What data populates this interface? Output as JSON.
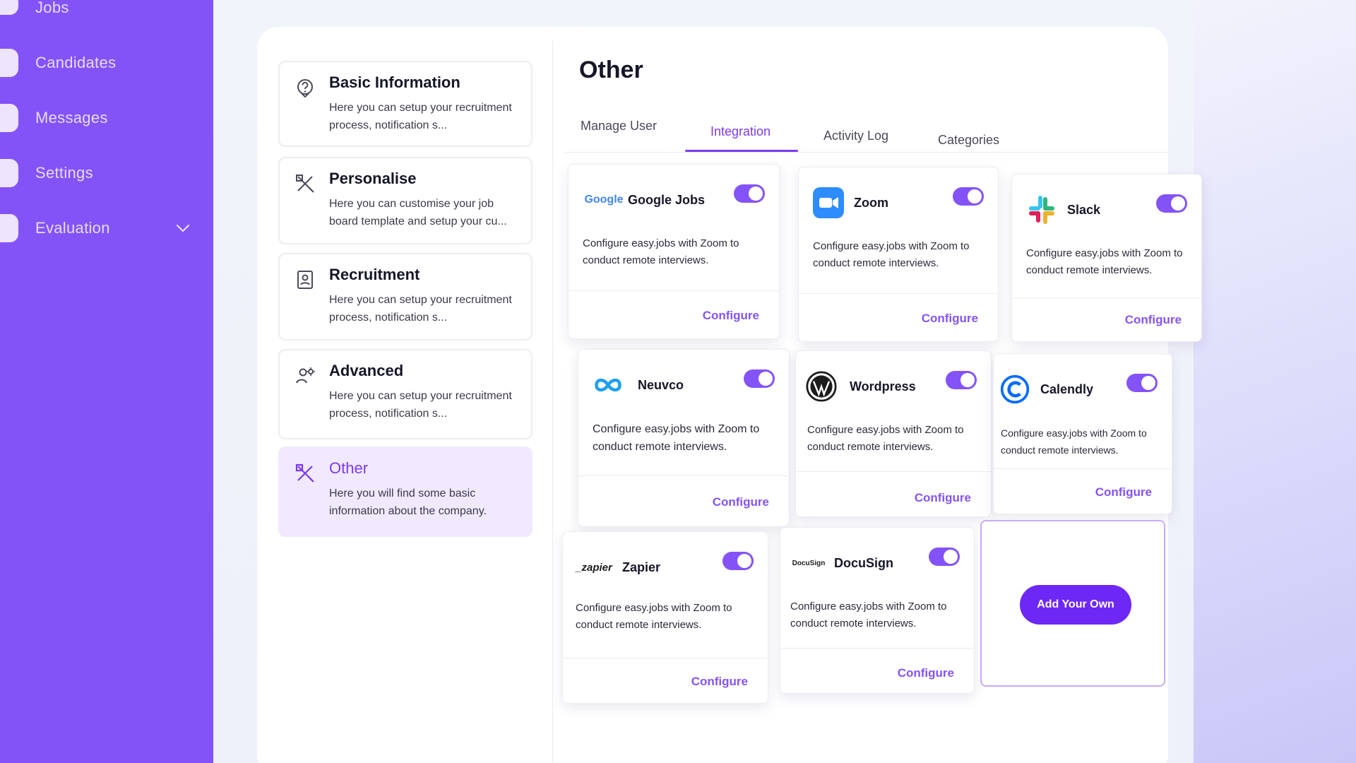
{
  "sidebar": {
    "items": [
      {
        "label": "Jobs"
      },
      {
        "label": "Candidates"
      },
      {
        "label": "Messages"
      },
      {
        "label": "Settings"
      },
      {
        "label": "Evaluation"
      }
    ]
  },
  "settings_list": [
    {
      "title": "Basic Information",
      "desc": "Here you can setup your recruitment process, notification s...",
      "icon": "question-circle-icon"
    },
    {
      "title": "Personalise",
      "desc": "Here you can customise your job board template and setup your cu...",
      "icon": "pencil-ruler-icon"
    },
    {
      "title": "Recruitment",
      "desc": "Here you can setup your recruitment process, notification s...",
      "icon": "id-card-icon"
    },
    {
      "title": "Advanced",
      "desc": "Here you can setup your recruitment process, notification s...",
      "icon": "user-gear-icon"
    },
    {
      "title": "Other",
      "desc": "Here you will find some basic information about the company.",
      "icon": "pencil-ruler-icon"
    }
  ],
  "page": {
    "title": "Other"
  },
  "tabs": [
    {
      "label": "Manage User"
    },
    {
      "label": "Integration",
      "active": true
    },
    {
      "label": "Activity Log"
    },
    {
      "label": "Categories"
    }
  ],
  "integrations": [
    {
      "name": "Google Jobs",
      "desc": "Configure easy.jobs with Zoom to conduct remote interviews.",
      "configure": "Configure",
      "enabled": true,
      "logo_text": "Google"
    },
    {
      "name": "Zoom",
      "desc": "Configure easy.jobs with Zoom to conduct remote interviews.",
      "configure": "Configure",
      "enabled": true
    },
    {
      "name": "Slack",
      "desc": "Configure easy.jobs with Zoom to conduct remote interviews.",
      "configure": "Configure",
      "enabled": true
    },
    {
      "name": "Neuvco",
      "desc": "Configure easy.jobs with Zoom to conduct remote interviews.",
      "configure": "Configure",
      "enabled": true
    },
    {
      "name": "Wordpress",
      "desc": "Configure easy.jobs with Zoom to conduct remote interviews.",
      "configure": "Configure",
      "enabled": true
    },
    {
      "name": "Calendly",
      "desc": "Configure easy.jobs with Zoom to conduct remote interviews.",
      "configure": "Configure",
      "enabled": true
    },
    {
      "name": "Zapier",
      "desc": "Configure easy.jobs with Zoom to conduct remote interviews.",
      "configure": "Configure",
      "enabled": true,
      "logo_text": "_zapier"
    },
    {
      "name": "DocuSign",
      "desc": "Configure easy.jobs with Zoom to conduct remote interviews.",
      "configure": "Configure",
      "enabled": true,
      "logo_text": "DocuSign"
    }
  ],
  "add_own": {
    "label": "Add Your Own"
  },
  "colors": {
    "accent": "#8453f8",
    "sidebar": "#8453f8",
    "button": "#6d28f5"
  }
}
